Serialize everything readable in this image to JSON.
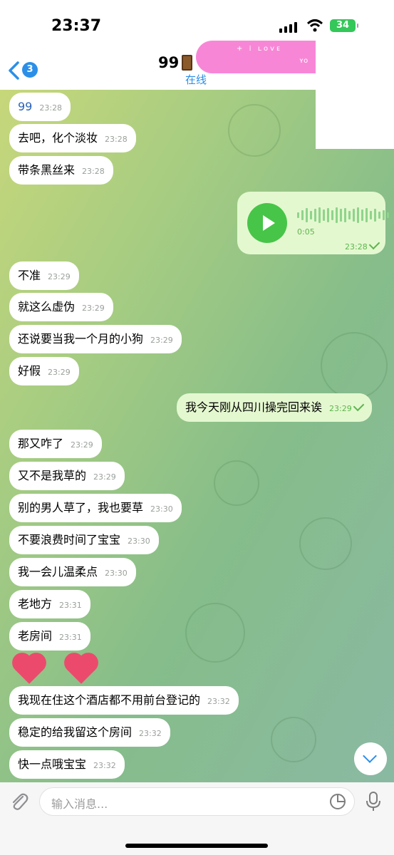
{
  "status_bar": {
    "time": "23:37",
    "battery": "34"
  },
  "header": {
    "back_badge": "3",
    "title": "99",
    "status": "在线"
  },
  "messages": [
    {
      "text": "99",
      "time": "23:28",
      "dir": "in"
    },
    {
      "text": "去吧，化个淡妆",
      "time": "23:28",
      "dir": "in"
    },
    {
      "text": "带条黑丝来",
      "time": "23:28",
      "dir": "in"
    },
    {
      "text": "不准",
      "time": "23:29",
      "dir": "in"
    },
    {
      "text": "就这么虚伪",
      "time": "23:29",
      "dir": "in"
    },
    {
      "text": "还说要当我一个月的小狗",
      "time": "23:29",
      "dir": "in"
    },
    {
      "text": "好假",
      "time": "23:29",
      "dir": "in"
    },
    {
      "text": "我今天刚从四川操完回来诶",
      "time": "23:29",
      "dir": "out"
    },
    {
      "text": "那又咋了",
      "time": "23:29",
      "dir": "in"
    },
    {
      "text": "又不是我草的",
      "time": "23:29",
      "dir": "in"
    },
    {
      "text": "别的男人草了，我也要草",
      "time": "23:30",
      "dir": "in"
    },
    {
      "text": "不要浪费时间了宝宝",
      "time": "23:30",
      "dir": "in"
    },
    {
      "text": "我一会儿温柔点",
      "time": "23:30",
      "dir": "in"
    },
    {
      "text": "老地方",
      "time": "23:31",
      "dir": "in"
    },
    {
      "text": "老房间",
      "time": "23:31",
      "dir": "in"
    },
    {
      "text": "我现在住这个酒店都不用前台登记的",
      "time": "23:32",
      "dir": "in"
    },
    {
      "text": "稳定的给我留这个房间",
      "time": "23:32",
      "dir": "in"
    },
    {
      "text": "快一点哦宝宝",
      "time": "23:32",
      "dir": "in"
    }
  ],
  "voice_message": {
    "duration": "0:05",
    "time": "23:28"
  },
  "input": {
    "placeholder": "输入消息..."
  },
  "colors": {
    "accent": "#2b8fe8",
    "outgoing_bubble": "#e4f8d0",
    "play_button": "#47c548"
  }
}
